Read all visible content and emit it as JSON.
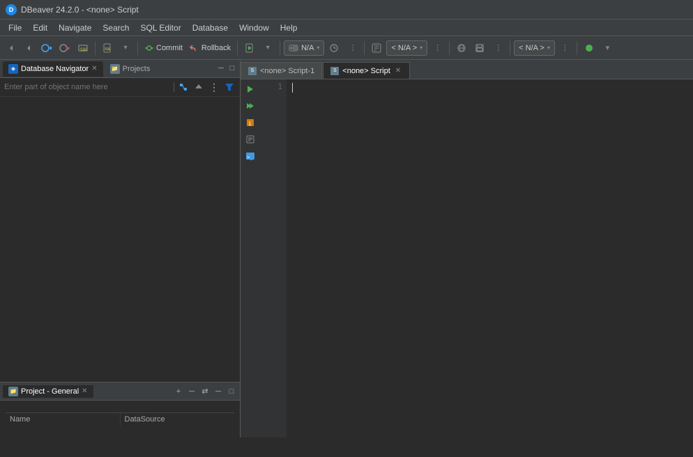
{
  "titleBar": {
    "icon": "DB",
    "title": "DBeaver 24.2.0 - <none> Script"
  },
  "menuBar": {
    "items": [
      "File",
      "Edit",
      "Navigate",
      "Search",
      "SQL Editor",
      "Database",
      "Window",
      "Help"
    ]
  },
  "toolbar": {
    "buttons": [
      "nav-back",
      "nav-forward",
      "nav-up",
      "nav-home"
    ],
    "sqlLabel": "SQL",
    "commitLabel": "Commit",
    "rollbackLabel": "Rollback",
    "connectionDropdown": "N/A",
    "schemaDropdown": "< N/A >",
    "rightDropdown": "< N/A >"
  },
  "leftPanel": {
    "tabs": [
      {
        "label": "Database Navigator",
        "active": true,
        "closable": true
      },
      {
        "label": "Projects",
        "active": false,
        "closable": false
      }
    ],
    "controls": {
      "minimize": "─",
      "maximize": "□"
    },
    "searchPlaceholder": "Enter part of object name here",
    "navButtons": [
      "↻",
      "↑",
      "⋮"
    ],
    "filterLabel": "▼"
  },
  "bottomLeftPanel": {
    "tabs": [
      {
        "label": "Project - General",
        "active": true,
        "closable": true
      }
    ],
    "controls": {
      "add": "+",
      "minus": "─",
      "arrows": "⇄",
      "minimize": "─",
      "maximize": "□"
    },
    "columns": [
      "Name",
      "DataSource"
    ]
  },
  "editorTabs": [
    {
      "label": "<none> Script-1",
      "active": false,
      "closable": false
    },
    {
      "label": "<none> Script",
      "active": true,
      "closable": true
    }
  ],
  "sqlEditor": {
    "sidebarButtons": [
      "▶",
      "▶▶",
      "📋",
      "📄",
      ">_"
    ],
    "lineNumbers": [
      "1"
    ]
  },
  "icons": {
    "play": "▶",
    "play2": "▶",
    "clipboard": "📋",
    "doc": "📄",
    "terminal": ">_",
    "folder": "📁",
    "db": "🗄",
    "refresh": "↻",
    "up": "↑",
    "more": "⋮",
    "filter": "▼",
    "close": "✕",
    "minimize": "─",
    "maximize": "□",
    "minus": "─",
    "add": "+",
    "swap": "⇄",
    "chevronDown": "▾"
  },
  "colors": {
    "accent": "#1565c0",
    "green": "#4caf50",
    "orange": "#ff8c00",
    "blue": "#42a5f5",
    "background": "#2b2b2b",
    "toolbar": "#3c3f41"
  }
}
